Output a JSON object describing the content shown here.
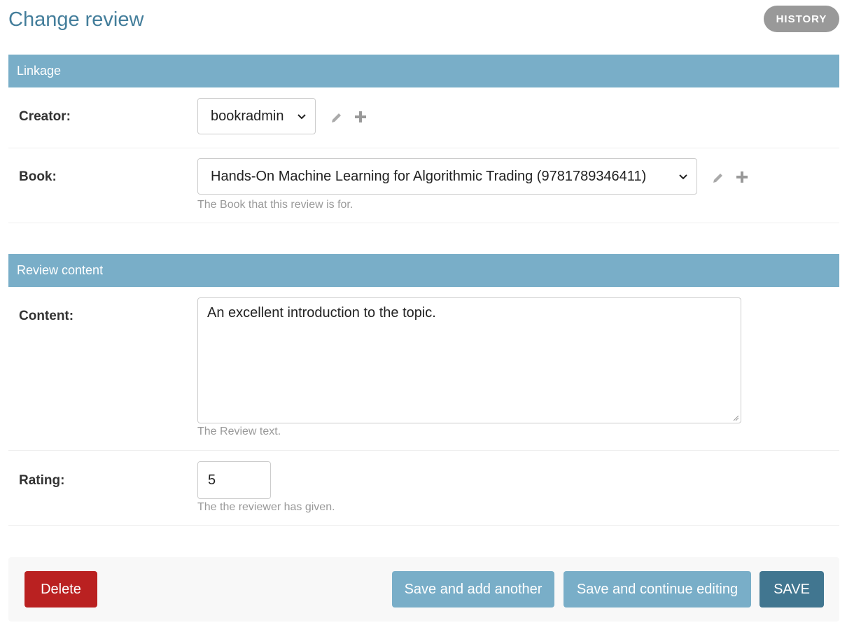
{
  "page": {
    "title": "Change review"
  },
  "object_tools": {
    "history_label": "HISTORY"
  },
  "fieldsets": [
    {
      "name": "Linkage"
    },
    {
      "name": "Review content"
    }
  ],
  "fields": {
    "creator": {
      "label": "Creator:",
      "value": "bookradmin"
    },
    "book": {
      "label": "Book:",
      "value": "Hands-On Machine Learning for Algorithmic Trading (9781789346411)",
      "help": "The Book that this review is for."
    },
    "content": {
      "label": "Content:",
      "value": "An excellent introduction to the topic.",
      "help": "The Review text."
    },
    "rating": {
      "label": "Rating:",
      "value": "5",
      "help": "The the reviewer has given."
    }
  },
  "actions": {
    "delete_label": "Delete",
    "save_add_another_label": "Save and add another",
    "save_continue_label": "Save and continue editing",
    "save_label": "SAVE"
  },
  "icons": {
    "edit": "pencil-icon",
    "add": "plus-icon",
    "dropdown": "chevron-down-icon"
  },
  "colors": {
    "header_bg": "#79aec8",
    "title": "#447e9b",
    "delete": "#ba2121",
    "save": "#417690"
  }
}
